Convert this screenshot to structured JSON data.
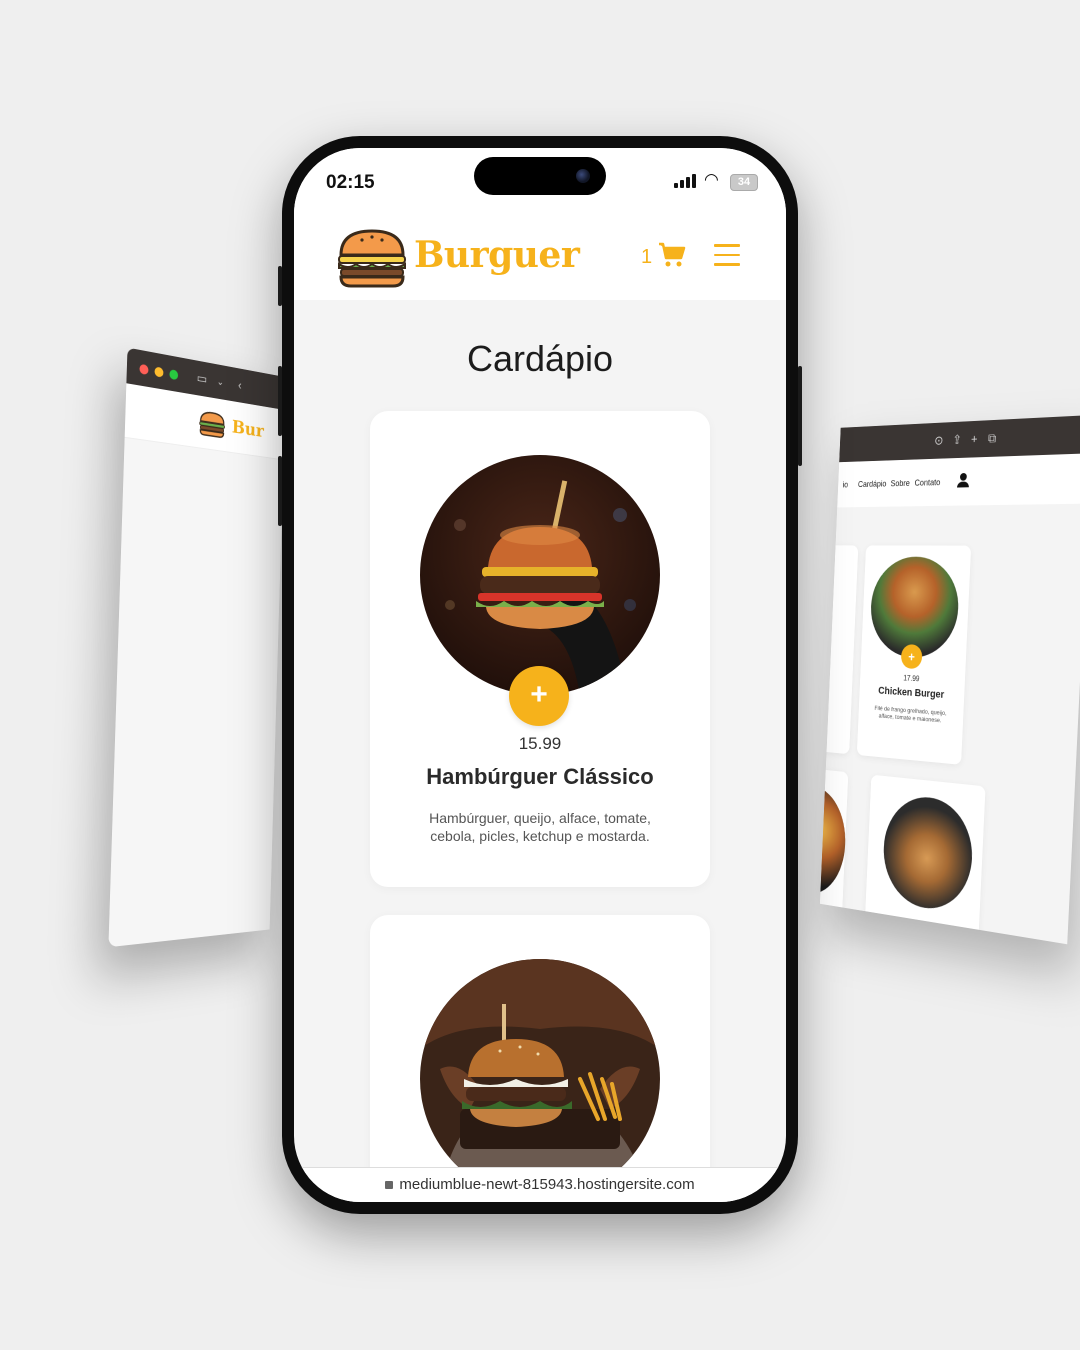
{
  "status_bar": {
    "time": "02:15",
    "battery": "34"
  },
  "header": {
    "brand": "Burguer",
    "cart_count": "1"
  },
  "page": {
    "title": "Cardápio"
  },
  "menu_items": [
    {
      "price": "15.99",
      "name": "Hambúrguer Clássico",
      "description": "Hambúrguer, queijo, alface, tomate, cebola, picles, ketchup e mostarda.",
      "add_label": "+"
    },
    {
      "add_label": "+"
    }
  ],
  "url_bar": {
    "url": "mediumblue-newt-815943.hostingersite.com"
  },
  "desktop_right": {
    "nav": [
      "io",
      "Cardápio",
      "Sobre",
      "Contato"
    ],
    "card": {
      "price": "17.99",
      "name": "Chicken Burger",
      "description": "Filé de frango grelhado, queijo, alface, tomate e maionese."
    }
  },
  "desktop_left": {
    "brand": "Bur"
  },
  "colors": {
    "accent": "#f6b21b",
    "background": "#efefef",
    "phone_frame": "#0d0d0d"
  },
  "icons": [
    "burger-logo-icon",
    "cart-icon",
    "hamburger-menu-icon",
    "plus-icon",
    "lock-icon",
    "wifi-icon",
    "signal-icon",
    "battery-icon",
    "user-icon"
  ]
}
